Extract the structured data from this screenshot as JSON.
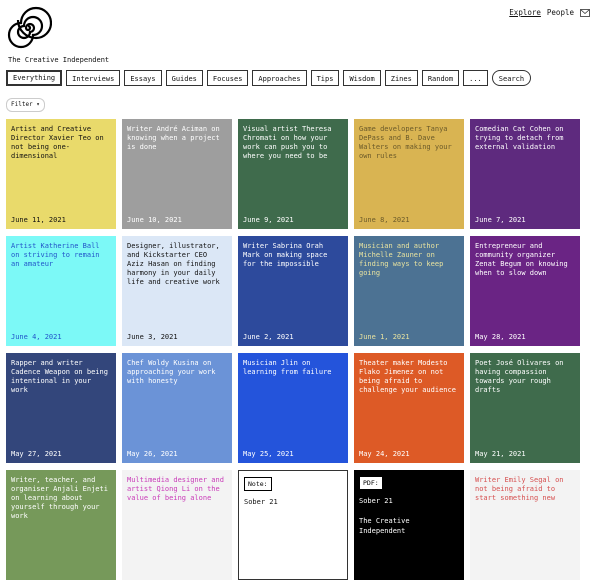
{
  "site": {
    "title": "The Creative Independent",
    "logo_icon": "spiral-logo-icon"
  },
  "topnav": {
    "explore": "Explore",
    "people": "People",
    "mail_icon": "mail-icon"
  },
  "nav": [
    {
      "label": "Everything",
      "active": true
    },
    {
      "label": "Interviews"
    },
    {
      "label": "Essays"
    },
    {
      "label": "Guides"
    },
    {
      "label": "Focuses"
    },
    {
      "label": "Approaches"
    },
    {
      "label": "Tips"
    },
    {
      "label": "Wisdom"
    },
    {
      "label": "Zines"
    },
    {
      "label": "Random"
    },
    {
      "label": "..."
    },
    {
      "label": "Search",
      "pill": true
    }
  ],
  "filter": {
    "label": "Filter ▾"
  },
  "cards": [
    {
      "title": "Artist and Creative Director Xavier Teo on not being one-dimensional",
      "date": "June 11, 2021",
      "bg": "#e9da6b",
      "fg": "#111111"
    },
    {
      "title": "Writer André Aciman on knowing when a project is done",
      "date": "June 10, 2021",
      "bg": "#9e9e9e",
      "fg": "#ffffff"
    },
    {
      "title": "Visual artist Theresa Chromati on how your work can push you to where you need to be",
      "date": "June 9, 2021",
      "bg": "#3f6b4c",
      "fg": "#ffffff"
    },
    {
      "title": "Game developers Tanya DePass and B. Dave Walters on making your own rules",
      "date": "June 8, 2021",
      "bg": "#d9b452",
      "fg": "#6b5a2a"
    },
    {
      "title": "Comedian Cat Cohen on trying to detach from external validation",
      "date": "June 7, 2021",
      "bg": "#5e2a7e",
      "fg": "#ffffff"
    },
    {
      "title": "Artist Katherine Ball on striving to remain an amateur",
      "date": "June 4, 2021",
      "bg": "#7cf9f7",
      "fg": "#2255c9"
    },
    {
      "title": "Designer, illustrator, and Kickstarter CEO Aziz Hasan on finding harmony in your daily life and creative work",
      "date": "June 3, 2021",
      "bg": "#dbe7f6",
      "fg": "#111111"
    },
    {
      "title": "Writer Sabrina Orah Mark on making space for the impossible",
      "date": "June 2, 2021",
      "bg": "#2d4a9c",
      "fg": "#ffffff"
    },
    {
      "title": "Musician and author Michelle Zauner on finding ways to keep going",
      "date": "June 1, 2021",
      "bg": "#4c7293",
      "fg": "#e8e3a0"
    },
    {
      "title": "Entrepreneur and community organizer Zenat Begum on knowing when to slow down",
      "date": "May 28, 2021",
      "bg": "#6a2484",
      "fg": "#ffffff"
    },
    {
      "title": "Rapper and writer Cadence Weapon on being intentional in your work",
      "date": "May 27, 2021",
      "bg": "#33467b",
      "fg": "#ffffff"
    },
    {
      "title": "Chef Woldy Kusina on approaching your work with honesty",
      "date": "May 26, 2021",
      "bg": "#6b93d7",
      "fg": "#ffffff"
    },
    {
      "title": "Musician Jlin on learning from failure",
      "date": "May 25, 2021",
      "bg": "#2454db",
      "fg": "#ffffff"
    },
    {
      "title": "Theater maker Modesto Flako Jimenez on not being afraid to challenge your audience",
      "date": "May 24, 2021",
      "bg": "#dd5a26",
      "fg": "#ffffff"
    },
    {
      "title": "Poet José Olivares on having compassion towards your rough drafts",
      "date": "May 21, 2021",
      "bg": "#3f6b4c",
      "fg": "#ffffff"
    },
    {
      "title": "Writer, teacher, and organiser Anjali Enjeti on learning about yourself through your work",
      "date": "",
      "bg": "#76995a",
      "fg": "#ffffff"
    },
    {
      "title": "Multimedia designer and artist Qiong Li on the value of being alone",
      "date": "",
      "bg": "#f3f3f3",
      "fg": "#c93bb8"
    },
    {
      "type": "note",
      "tag": "Note:",
      "lines": [
        "Sober 21"
      ],
      "bg": "#ffffff",
      "fg": "#111111"
    },
    {
      "type": "pdf",
      "tag": "PDF:",
      "lines": [
        "Sober 21",
        "",
        "The Creative Independent"
      ],
      "bg": "#000000",
      "fg": "#ffffff"
    },
    {
      "title": "Writer Emily Segal on not being afraid to start something new",
      "date": "",
      "bg": "#f3f3f3",
      "fg": "#d65050"
    }
  ]
}
